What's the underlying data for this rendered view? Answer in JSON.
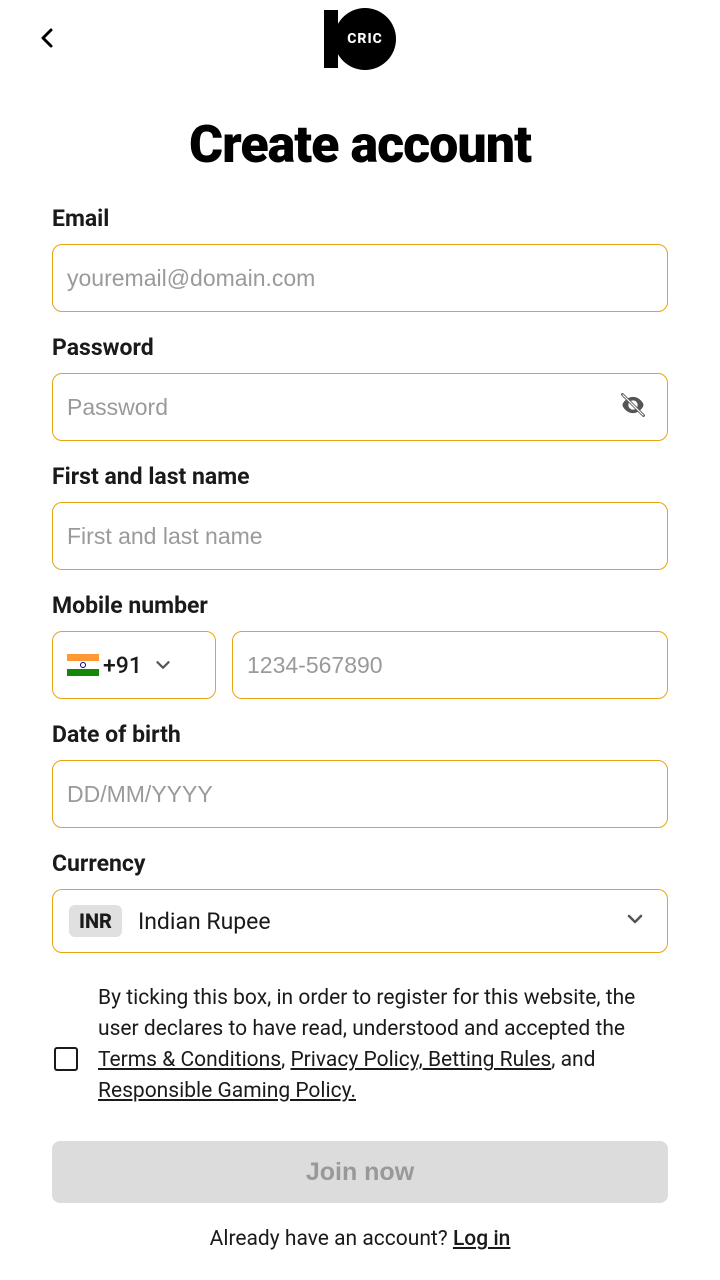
{
  "logo_text": "CRIC",
  "title": "Create account",
  "fields": {
    "email": {
      "label": "Email",
      "placeholder": "youremail@domain.com",
      "value": ""
    },
    "password": {
      "label": "Password",
      "placeholder": "Password",
      "value": ""
    },
    "name": {
      "label": "First and last name",
      "placeholder": "First and last name",
      "value": ""
    },
    "mobile": {
      "label": "Mobile number",
      "dial_code": "+91",
      "placeholder": "1234-567890",
      "value": ""
    },
    "dob": {
      "label": "Date of birth",
      "placeholder": "DD/MM/YYYY",
      "value": ""
    },
    "currency": {
      "label": "Currency",
      "code": "INR",
      "name": "Indian Rupee"
    }
  },
  "terms": {
    "prefix": "By ticking this box, in order to register for this website, the user declares to have read, understood and accepted the",
    "link1": " Terms & Conditions",
    "sep1": ", ",
    "link2": "Privacy Policy,",
    "link3": " Betting Rules",
    "sep2": ", and ",
    "link4": "Responsible Gaming Policy."
  },
  "join_label": "Join now",
  "login_prompt": "Already have an account? ",
  "login_link": "Log in"
}
